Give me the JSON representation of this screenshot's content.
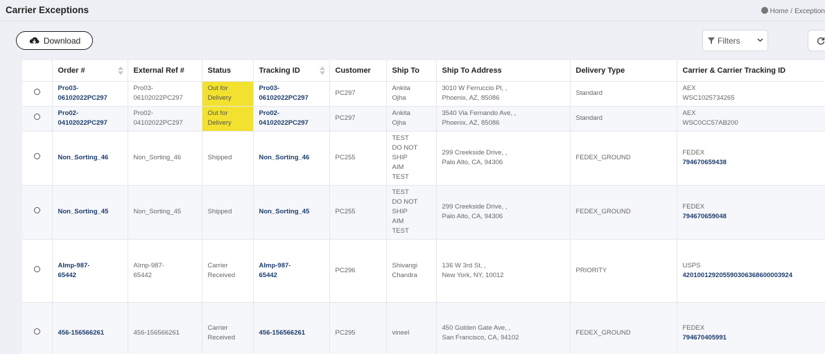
{
  "header": {
    "title": "Carrier Exceptions",
    "breadcrumb_home": "Home",
    "breadcrumb_sep": "/",
    "breadcrumb_current": "Exception"
  },
  "toolbar": {
    "download_label": "Download",
    "filters_label": "Filters"
  },
  "table": {
    "columns": [
      "Order #",
      "External Ref #",
      "Status",
      "Tracking ID",
      "Customer",
      "Ship To",
      "Ship To Address",
      "Delivery Type",
      "Carrier & Carrier Tracking ID"
    ],
    "rows": [
      {
        "order": "Pro03-\n06102022PC297",
        "ext_ref": "Pro03-\n06102022PC297",
        "status": "Out for\nDelivery",
        "tracking": "Pro03-\n06102022PC297",
        "customer": "PC297",
        "ship_to": "Ankita\nOjha",
        "address": "3010 W Ferruccio Pl, ,\nPhoenix, AZ, 85086",
        "delivery": "Standard",
        "carrier": "AEX",
        "carrier_id": "WSC1025734265"
      },
      {
        "order": "Pro02-\n04102022PC297",
        "ext_ref": "Pro02-\n04102022PC297",
        "status": "Out for\nDelivery",
        "tracking": "Pro02-\n04102022PC297",
        "customer": "PC297",
        "ship_to": "Ankita\nOjha",
        "address": "3540 Via Fernando Ave, ,\nPhoenix, AZ, 85086",
        "delivery": "Standard",
        "carrier": "AEX",
        "carrier_id": "WSC0CC57AB200"
      },
      {
        "order": "Non_Sorting_46",
        "ext_ref": "Non_Sorting_46",
        "status": "Shipped",
        "tracking": "Non_Sorting_46",
        "customer": "PC255",
        "ship_to": "TEST\nDO NOT\nSHIP\nAIM\nTEST",
        "address": "299 Creekside Drive, ,\nPalo Alto, CA, 94306",
        "delivery": "FEDEX_GROUND",
        "carrier": "FEDEX",
        "carrier_id": "794670659438"
      },
      {
        "order": "Non_Sorting_45",
        "ext_ref": "Non_Sorting_45",
        "status": "Shipped",
        "tracking": "Non_Sorting_45",
        "customer": "PC255",
        "ship_to": "TEST\nDO NOT\nSHIP\nAIM\nTEST",
        "address": "299 Creekside Drive, ,\nPalo Alto, CA, 94306",
        "delivery": "FEDEX_GROUND",
        "carrier": "FEDEX",
        "carrier_id": "794670659048"
      },
      {
        "order": "AImp-987-\n65442",
        "ext_ref": "AImp-987-\n65442",
        "status": "Carrier\nReceived",
        "tracking": "AImp-987-\n65442",
        "customer": "PC296",
        "ship_to": "Shivangi\nChandra",
        "address": "136 W 3rd St, ,\nNew York, NY, 10012",
        "delivery": "PRIORITY",
        "carrier": "USPS",
        "carrier_id": "420100129205590306368600003924"
      },
      {
        "order": "456-156566261",
        "ext_ref": "456-156566261",
        "status": "Carrier\nReceived",
        "tracking": "456-156566261",
        "customer": "PC295",
        "ship_to": "vineel",
        "address": "450 Golden Gate Ave, ,\nSan Francisco, CA, 94102",
        "delivery": "FEDEX_GROUND",
        "carrier": "FEDEX",
        "carrier_id": "794670405991"
      }
    ]
  },
  "colors": {
    "status_highlight": "#f2e12e",
    "link": "#1d3d6e"
  }
}
